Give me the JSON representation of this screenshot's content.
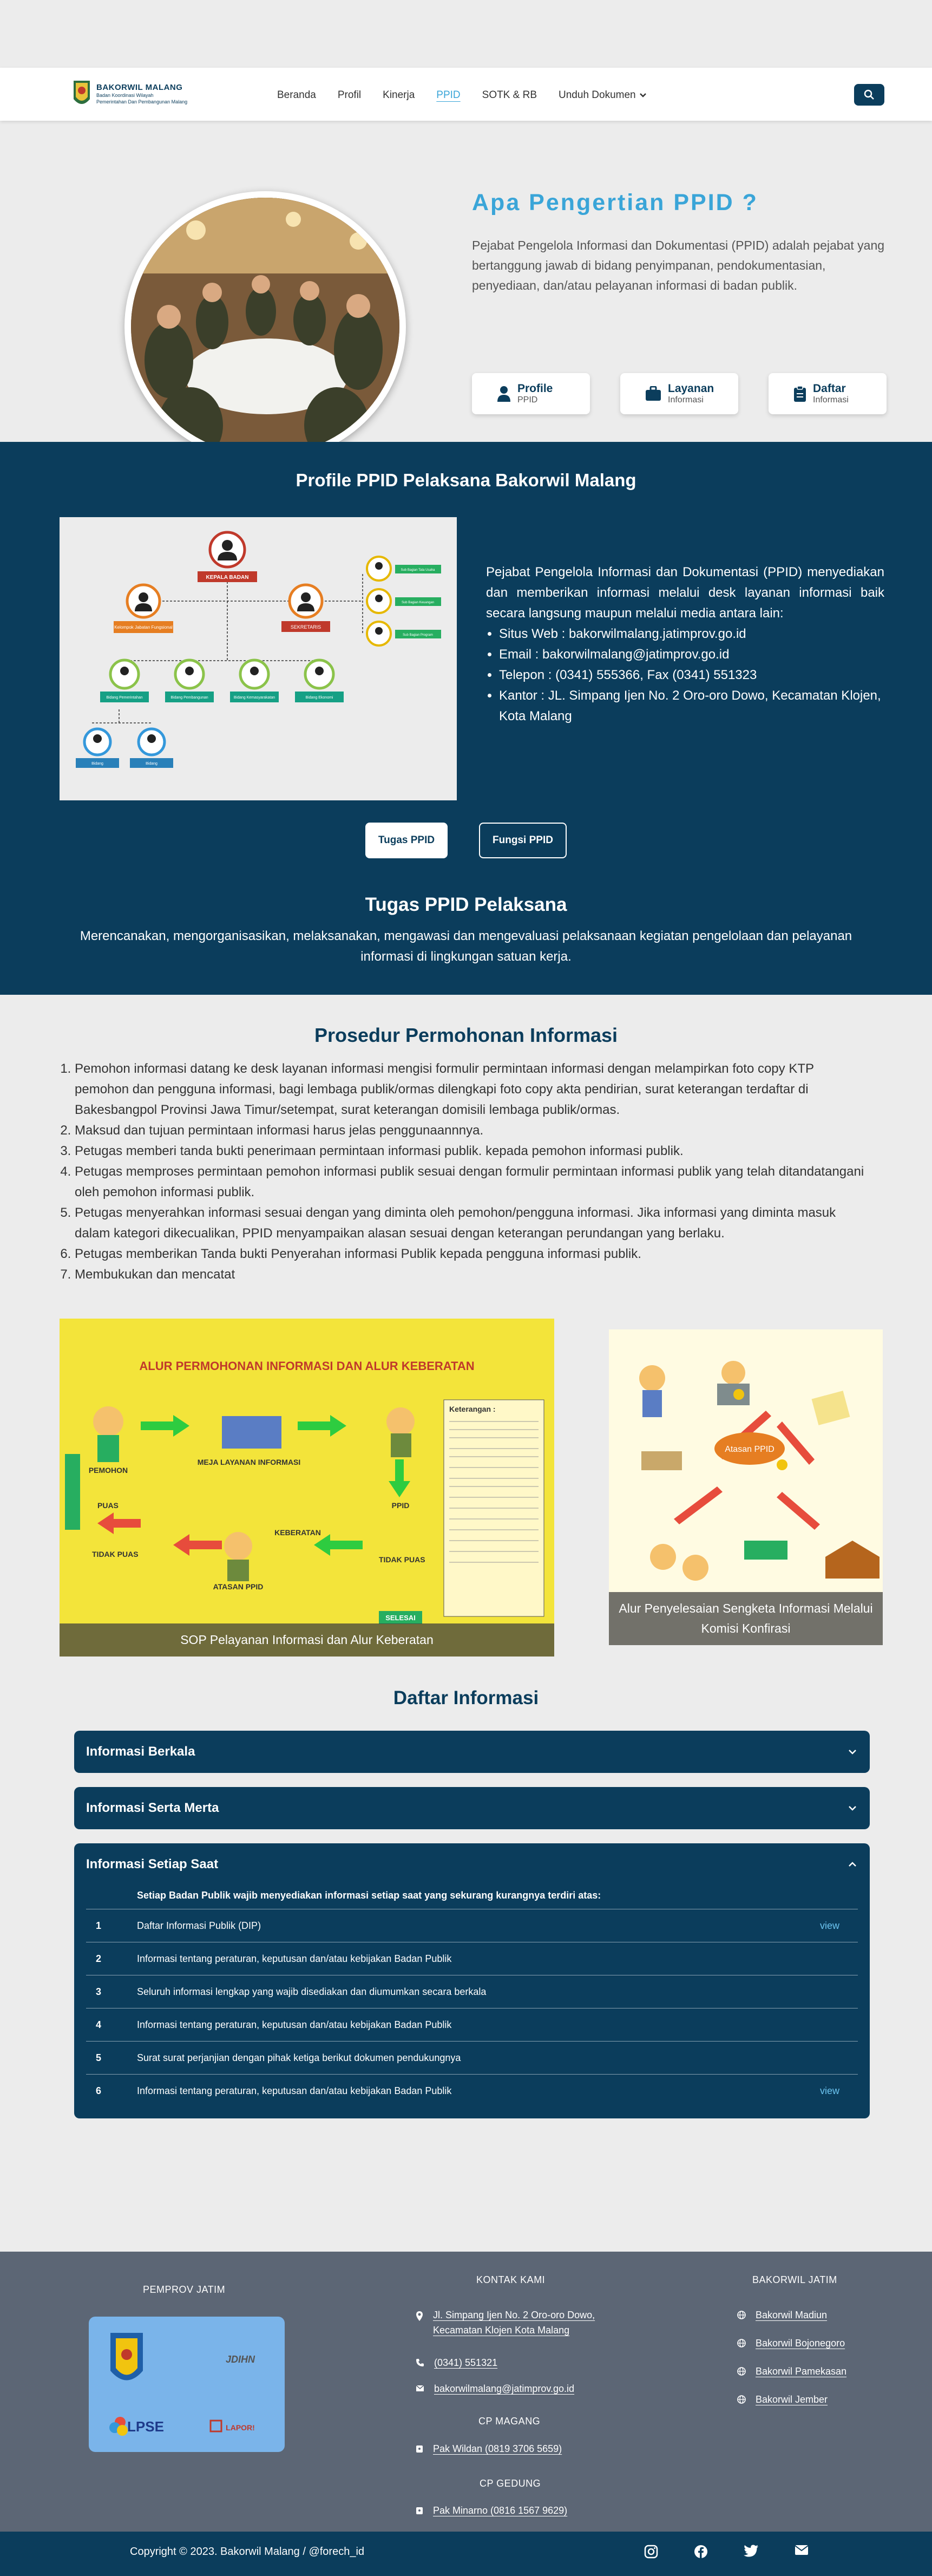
{
  "brand": {
    "name": "BAKORWIL MALANG",
    "line2": "Badan Koordinasi Wilayah",
    "line3": "Pemerintahan Dan Pembangunan Malang"
  },
  "nav": {
    "items": [
      "Beranda",
      "Profil",
      "Kinerja",
      "PPID",
      "SOTK & RB",
      "Unduh Dokumen"
    ],
    "active": "PPID"
  },
  "hero": {
    "title": "Apa Pengertian PPID ?",
    "description": "Pejabat Pengelola Informasi dan Dokumentasi (PPID) adalah pejabat yang bertanggung jawab di bidang penyimpanan, pendokumentasian, penyediaan, dan/atau pelayanan informasi di badan publik.",
    "cards": [
      {
        "title": "Profile",
        "sub": "PPID",
        "icon": "user-icon"
      },
      {
        "title": "Layanan",
        "sub": "Informasi",
        "icon": "briefcase-icon"
      },
      {
        "title": "Daftar",
        "sub": "Informasi",
        "icon": "clipboard-icon"
      }
    ]
  },
  "profile": {
    "title": "Profile PPID Pelaksana Bakorwil Malang",
    "intro": "Pejabat Pengelola Informasi dan Dokumentasi (PPID) menyediakan dan memberikan informasi melalui desk layanan informasi baik secara langsung maupun melalui media antara lain:",
    "contacts": [
      "Situs Web : bakorwilmalang.jatimprov.go.id",
      "Email : bakorwilmalang@jatimprov.go.id",
      "Telepon : (0341) 555366, Fax (0341) 551323",
      "Kantor : JL. Simpang Ijen No. 2 Oro-oro Dowo, Kecamatan Klojen, Kota Malang"
    ],
    "org": {
      "top": "KEPALA BADAN",
      "left": "Kelompok Jabatan Fungsional",
      "mid": "SEKRETARIS",
      "right": [
        "Sub Bagian Tata Usaha",
        "Sub Bagian Keuangan",
        "Sub Bagian Program"
      ],
      "row3": [
        "Bidang Pemerintahan",
        "Bidang Pembangunan",
        "Bidang Kemasyarakatan",
        "Bidang Ekonomi"
      ],
      "row4": [
        "Bidang",
        "Bidang"
      ]
    },
    "tab_on": "Tugas PPID",
    "tab_off": "Fungsi PPID",
    "tugas_title": "Tugas PPID Pelaksana",
    "tugas_text": "Merencanakan, mengorganisasikan, melaksanakan, mengawasi dan mengevaluasi pelaksanaan kegiatan pengelolaan dan pelayanan informasi di lingkungan satuan kerja."
  },
  "prosedur": {
    "title": "Prosedur Permohonan Informasi",
    "steps": [
      "Pemohon informasi datang ke desk layanan informasi mengisi formulir permintaan informasi dengan melampirkan foto copy KTP pemohon dan pengguna informasi, bagi lembaga publik/ormas dilengkapi foto copy akta pendirian, surat keterangan terdaftar di Bakesbangpol Provinsi Jawa Timur/setempat, surat keterangan domisili lembaga publik/ormas.",
      "Maksud dan tujuan permintaan informasi harus jelas penggunaannnya.",
      "Petugas memberi tanda bukti penerimaan permintaan informasi publik. kepada pemohon informasi publik.",
      "Petugas memproses permintaan pemohon informasi publik sesuai dengan formulir permintaan informasi publik yang telah ditandatangani oleh pemohon informasi publik.",
      "Petugas menyerahkan informasi sesuai dengan yang diminta oleh pemohon/pengguna informasi. Jika informasi yang diminta masuk dalam kategori dikecualikan, PPID menyampaikan alasan sesuai dengan keterangan perundangan yang berlaku.",
      "Petugas memberikan Tanda bukti Penyerahan informasi Publik kepada pengguna informasi publik.",
      "Membukukan dan mencatat"
    ],
    "img1": {
      "heading": "ALUR PERMOHONAN INFORMASI DAN ALUR KEBERATAN",
      "caption": "SOP Pelayanan Informasi dan Alur Keberatan",
      "labels": [
        "PEMOHON",
        "MEJA LAYANAN INFORMASI",
        "PPID",
        "PUAS",
        "TIDAK PUAS",
        "ATASAN PPID",
        "KEBERATAN",
        "TIDAK PUAS",
        "SELESAI",
        "Keterangan :"
      ]
    },
    "img2": {
      "caption": "Alur Penyelesaian Sengketa Informasi Melalui Komisi Konfirasi",
      "labels": [
        "Atasan PPID"
      ]
    }
  },
  "daftar": {
    "title": "Daftar Informasi",
    "sections": [
      "Informasi Berkala",
      "Informasi Serta Merta",
      "Informasi Setiap Saat"
    ],
    "intro": "Setiap Badan Publik wajib menyediakan informasi setiap saat yang sekurang kurangnya terdiri atas:",
    "rows": [
      {
        "no": "1",
        "text": "Daftar Informasi Publik (DIP)",
        "link": "view"
      },
      {
        "no": "2",
        "text": "Informasi tentang peraturan, keputusan dan/atau kebijakan Badan Publik",
        "link": ""
      },
      {
        "no": "3",
        "text": "Seluruh informasi lengkap yang wajib disediakan dan diumumkan secara berkala",
        "link": ""
      },
      {
        "no": "4",
        "text": "Informasi tentang peraturan, keputusan dan/atau kebijakan Badan Publik",
        "link": ""
      },
      {
        "no": "5",
        "text": "Surat surat perjanjian dengan pihak ketiga berikut dokumen pendukungnya",
        "link": ""
      },
      {
        "no": "6",
        "text": "Informasi tentang peraturan, keputusan dan/atau kebijakan Badan Publik",
        "link": "view"
      }
    ]
  },
  "footer": {
    "col1_title": "PEMPROV JATIM",
    "partners": [
      "JDIHN",
      "LPSE",
      "LAPOR!"
    ],
    "kontak_title": "KONTAK KAMI",
    "address": "Jl. Simpang Ijen No. 2 Oro-oro Dowo, Kecamatan Klojen Kota Malang",
    "phone": "(0341) 551321",
    "email": "bakorwilmalang@jatimprov.go.id",
    "cp_magang_title": "CP MAGANG",
    "cp_magang": "Pak Wildan (0819 3706 5659)",
    "cp_gedung_title": "CP GEDUNG",
    "cp_gedung": "Pak Minarno (0816 1567 9629)",
    "col3_title": "BAKORWIL JATIM",
    "links": [
      "Bakorwil Madiun",
      "Bakorwil Bojonegoro",
      "Bakorwil Pamekasan",
      "Bakorwil Jember"
    ],
    "copyright": "Copyright © 2023. Bakorwil Malang / @forech_id",
    "socials": [
      "instagram-icon",
      "facebook-icon",
      "twitter-icon",
      "email-icon"
    ]
  },
  "colors": {
    "navy": "#0b3d5c",
    "accent": "#3aa5d8",
    "footer": "#5c6675"
  }
}
